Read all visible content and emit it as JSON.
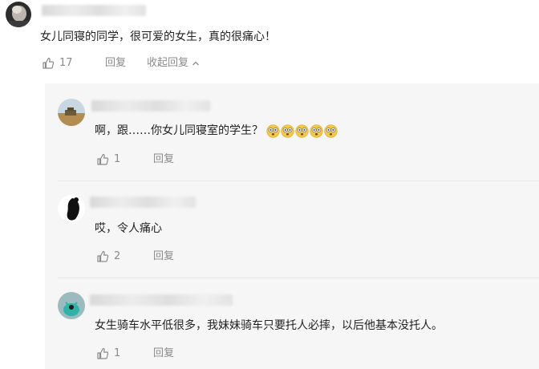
{
  "main_comment": {
    "text": "女儿同寝的同学，很可爱的女生，真的很痛心！",
    "like_count": "17",
    "reply_label": "回复",
    "collapse_label": "收起回复"
  },
  "replies": [
    {
      "text": "啊，跟……你女儿同寝室的学生？",
      "emoji_count": 5,
      "emoji_name": "dizzy-face-emoji",
      "like_count": "1",
      "reply_label": "回复"
    },
    {
      "text": "哎，令人痛心",
      "like_count": "2",
      "reply_label": "回复"
    },
    {
      "text": "女生骑车水平低很多，我妹妹骑车只要托人必摔，以后他基本没托人。",
      "like_count": "1",
      "reply_label": "回复"
    }
  ],
  "colors": {
    "panel_bg": "#f6f6f6",
    "meta_text": "#8a8a8a",
    "body_text": "#222222"
  }
}
